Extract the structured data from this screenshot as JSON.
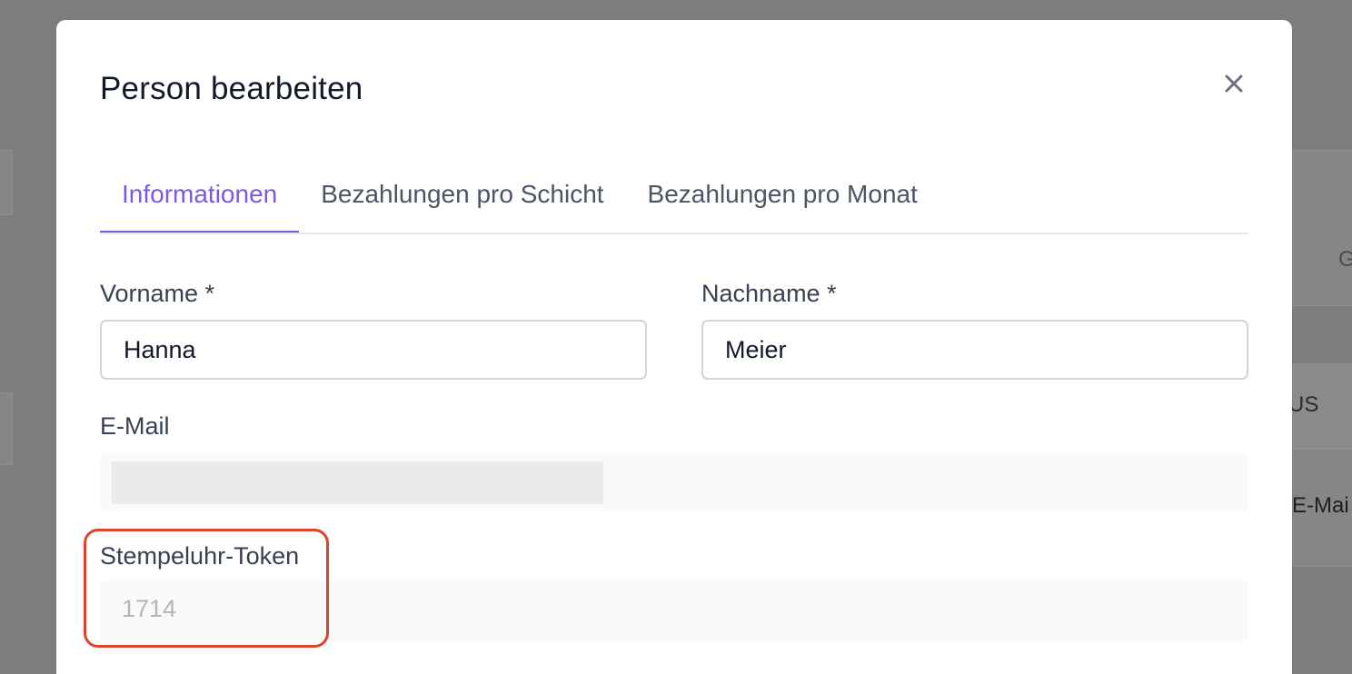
{
  "background": {
    "partial_texts": [
      "G",
      "US",
      "E-Mai"
    ]
  },
  "modal": {
    "title": "Person bearbeiten",
    "close_icon": "close-icon",
    "tabs": [
      {
        "label": "Informationen",
        "active": true
      },
      {
        "label": "Bezahlungen pro Schicht",
        "active": false
      },
      {
        "label": "Bezahlungen pro Monat",
        "active": false
      }
    ],
    "fields": {
      "first_name": {
        "label": "Vorname *",
        "value": "Hanna"
      },
      "last_name": {
        "label": "Nachname *",
        "value": "Meier"
      },
      "email": {
        "label": "E-Mail",
        "value": ""
      },
      "token": {
        "label": "Stempeluhr-Token",
        "value": "1714"
      }
    }
  },
  "colors": {
    "accent": "#7c5ae0",
    "highlight": "#e0432b",
    "overlay": "#7c7d7d"
  }
}
